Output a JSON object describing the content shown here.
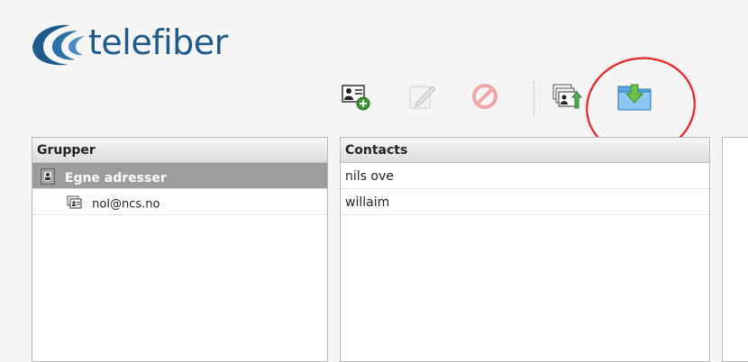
{
  "brand": {
    "name": "telefiber"
  },
  "toolbar": {
    "buttons": [
      {
        "name": "add-contact",
        "icon": "add-contact-icon",
        "enabled": true
      },
      {
        "name": "edit-contact",
        "icon": "edit-pencil-icon",
        "enabled": false
      },
      {
        "name": "delete-contact",
        "icon": "delete-icon",
        "enabled": false
      },
      {
        "name": "export-contacts",
        "icon": "export-contacts-icon",
        "enabled": true
      },
      {
        "name": "import-contacts",
        "icon": "import-folder-icon",
        "enabled": true
      }
    ]
  },
  "groups": {
    "header": "Grupper",
    "items": [
      {
        "label": "Egne adresser",
        "icon": "address-book-icon",
        "selected": true
      },
      {
        "label": "nol@ncs.no",
        "icon": "contact-group-icon",
        "selected": false
      }
    ]
  },
  "contacts": {
    "header": "Contacts",
    "items": [
      {
        "label": "nils ove"
      },
      {
        "label": "willaim"
      }
    ]
  },
  "colors": {
    "brand": "#1f5a8c",
    "highlight": "#e21b1b",
    "selected_row": "#9c9c9c"
  }
}
